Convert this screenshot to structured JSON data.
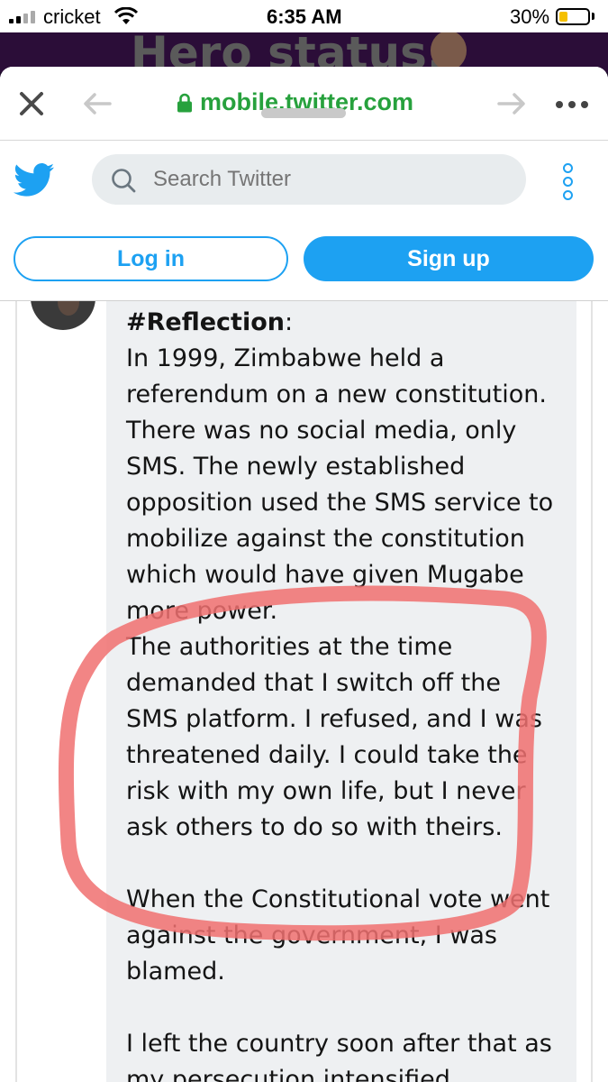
{
  "status_bar": {
    "carrier": "cricket",
    "time": "6:35 AM",
    "battery": "30%",
    "battery_level": 0.3
  },
  "background_page": {
    "heading": "Hero status."
  },
  "browser": {
    "url": "mobile.twitter.com",
    "icons": [
      "close-icon",
      "back-arrow-icon",
      "lock-icon",
      "forward-arrow-icon",
      "more-icon"
    ]
  },
  "twitter_header": {
    "search_placeholder": "Search Twitter",
    "login_label": "Log in",
    "signup_label": "Sign up",
    "icons": [
      "twitter-bird-icon",
      "search-icon",
      "kebab-menu-icon"
    ]
  },
  "tweet": {
    "hashtag": "#Reflection",
    "hashtag_suffix": ":",
    "lines": [
      "In 1999, Zimbabwe held a",
      "referendum on a new constitution.",
      "There was no social media, only",
      "SMS. The newly established",
      "opposition used the SMS service to",
      "mobilize against the constitution",
      "which would have given Mugabe",
      "more power.",
      "The authorities at the time",
      "demanded that I switch off the",
      "SMS platform. I refused, and I was",
      "threatened daily. I could take the",
      "risk with my own life, but I never",
      "ask others to do so with theirs.",
      "",
      "When the Constitutional vote went",
      "against the government, I was",
      "blamed.",
      "",
      "I left the country soon after that as",
      "my persecution intensified."
    ]
  },
  "colors": {
    "twitter_blue": "#1da1f2",
    "url_green": "#27a13d",
    "highlight_red": "#f07070",
    "battery_yellow": "#f5c000"
  }
}
